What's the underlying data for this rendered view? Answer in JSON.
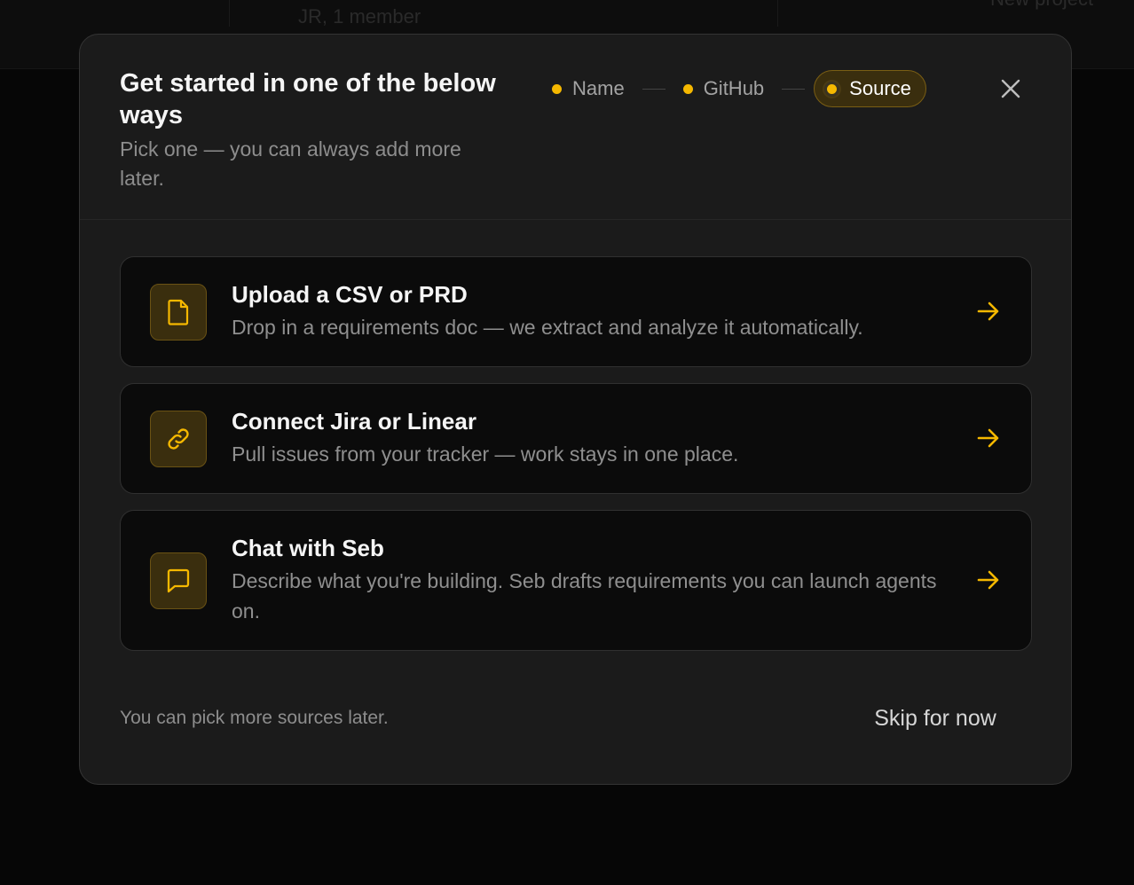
{
  "background": {
    "left_text": "JR, 1 member",
    "right_text": "New project"
  },
  "header": {
    "title": "Get started in one of the below ways",
    "subtitle": "Pick one — you can always add more later."
  },
  "stepper": {
    "steps": [
      {
        "label": "Name",
        "state": "done"
      },
      {
        "label": "GitHub",
        "state": "done"
      },
      {
        "label": "Source",
        "state": "active"
      }
    ]
  },
  "options": [
    {
      "title": "Upload a CSV or PRD",
      "description": "Drop in a requirements doc — we extract and analyze it automatically.",
      "icon": "file-icon"
    },
    {
      "title": "Connect Jira or Linear",
      "description": "Pull issues from your tracker — work stays in one place.",
      "icon": "link-icon"
    },
    {
      "title": "Chat with Seb",
      "description": "Describe what you're building. Seb drafts requirements you can launch agents on.",
      "icon": "chat-bubble-icon"
    }
  ],
  "footer": {
    "note": "You can pick more sources later.",
    "skip_label": "Skip for now"
  },
  "colors": {
    "accent": "#f5b800",
    "modal_bg": "#1b1b1b",
    "card_bg": "#0b0b0b"
  }
}
